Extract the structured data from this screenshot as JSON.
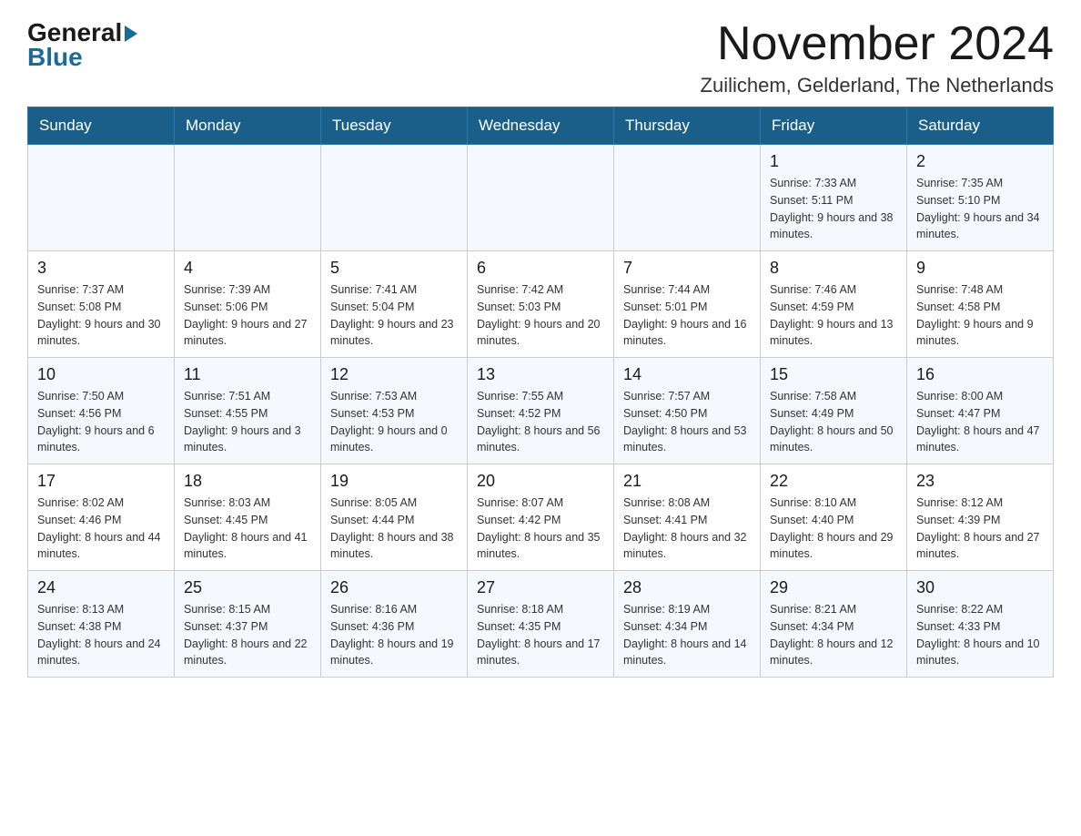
{
  "logo": {
    "general": "General",
    "blue": "Blue"
  },
  "header": {
    "title": "November 2024",
    "location": "Zuilichem, Gelderland, The Netherlands"
  },
  "days_of_week": [
    "Sunday",
    "Monday",
    "Tuesday",
    "Wednesday",
    "Thursday",
    "Friday",
    "Saturday"
  ],
  "weeks": [
    [
      {
        "day": "",
        "info": ""
      },
      {
        "day": "",
        "info": ""
      },
      {
        "day": "",
        "info": ""
      },
      {
        "day": "",
        "info": ""
      },
      {
        "day": "",
        "info": ""
      },
      {
        "day": "1",
        "info": "Sunrise: 7:33 AM\nSunset: 5:11 PM\nDaylight: 9 hours and 38 minutes."
      },
      {
        "day": "2",
        "info": "Sunrise: 7:35 AM\nSunset: 5:10 PM\nDaylight: 9 hours and 34 minutes."
      }
    ],
    [
      {
        "day": "3",
        "info": "Sunrise: 7:37 AM\nSunset: 5:08 PM\nDaylight: 9 hours and 30 minutes."
      },
      {
        "day": "4",
        "info": "Sunrise: 7:39 AM\nSunset: 5:06 PM\nDaylight: 9 hours and 27 minutes."
      },
      {
        "day": "5",
        "info": "Sunrise: 7:41 AM\nSunset: 5:04 PM\nDaylight: 9 hours and 23 minutes."
      },
      {
        "day": "6",
        "info": "Sunrise: 7:42 AM\nSunset: 5:03 PM\nDaylight: 9 hours and 20 minutes."
      },
      {
        "day": "7",
        "info": "Sunrise: 7:44 AM\nSunset: 5:01 PM\nDaylight: 9 hours and 16 minutes."
      },
      {
        "day": "8",
        "info": "Sunrise: 7:46 AM\nSunset: 4:59 PM\nDaylight: 9 hours and 13 minutes."
      },
      {
        "day": "9",
        "info": "Sunrise: 7:48 AM\nSunset: 4:58 PM\nDaylight: 9 hours and 9 minutes."
      }
    ],
    [
      {
        "day": "10",
        "info": "Sunrise: 7:50 AM\nSunset: 4:56 PM\nDaylight: 9 hours and 6 minutes."
      },
      {
        "day": "11",
        "info": "Sunrise: 7:51 AM\nSunset: 4:55 PM\nDaylight: 9 hours and 3 minutes."
      },
      {
        "day": "12",
        "info": "Sunrise: 7:53 AM\nSunset: 4:53 PM\nDaylight: 9 hours and 0 minutes."
      },
      {
        "day": "13",
        "info": "Sunrise: 7:55 AM\nSunset: 4:52 PM\nDaylight: 8 hours and 56 minutes."
      },
      {
        "day": "14",
        "info": "Sunrise: 7:57 AM\nSunset: 4:50 PM\nDaylight: 8 hours and 53 minutes."
      },
      {
        "day": "15",
        "info": "Sunrise: 7:58 AM\nSunset: 4:49 PM\nDaylight: 8 hours and 50 minutes."
      },
      {
        "day": "16",
        "info": "Sunrise: 8:00 AM\nSunset: 4:47 PM\nDaylight: 8 hours and 47 minutes."
      }
    ],
    [
      {
        "day": "17",
        "info": "Sunrise: 8:02 AM\nSunset: 4:46 PM\nDaylight: 8 hours and 44 minutes."
      },
      {
        "day": "18",
        "info": "Sunrise: 8:03 AM\nSunset: 4:45 PM\nDaylight: 8 hours and 41 minutes."
      },
      {
        "day": "19",
        "info": "Sunrise: 8:05 AM\nSunset: 4:44 PM\nDaylight: 8 hours and 38 minutes."
      },
      {
        "day": "20",
        "info": "Sunrise: 8:07 AM\nSunset: 4:42 PM\nDaylight: 8 hours and 35 minutes."
      },
      {
        "day": "21",
        "info": "Sunrise: 8:08 AM\nSunset: 4:41 PM\nDaylight: 8 hours and 32 minutes."
      },
      {
        "day": "22",
        "info": "Sunrise: 8:10 AM\nSunset: 4:40 PM\nDaylight: 8 hours and 29 minutes."
      },
      {
        "day": "23",
        "info": "Sunrise: 8:12 AM\nSunset: 4:39 PM\nDaylight: 8 hours and 27 minutes."
      }
    ],
    [
      {
        "day": "24",
        "info": "Sunrise: 8:13 AM\nSunset: 4:38 PM\nDaylight: 8 hours and 24 minutes."
      },
      {
        "day": "25",
        "info": "Sunrise: 8:15 AM\nSunset: 4:37 PM\nDaylight: 8 hours and 22 minutes."
      },
      {
        "day": "26",
        "info": "Sunrise: 8:16 AM\nSunset: 4:36 PM\nDaylight: 8 hours and 19 minutes."
      },
      {
        "day": "27",
        "info": "Sunrise: 8:18 AM\nSunset: 4:35 PM\nDaylight: 8 hours and 17 minutes."
      },
      {
        "day": "28",
        "info": "Sunrise: 8:19 AM\nSunset: 4:34 PM\nDaylight: 8 hours and 14 minutes."
      },
      {
        "day": "29",
        "info": "Sunrise: 8:21 AM\nSunset: 4:34 PM\nDaylight: 8 hours and 12 minutes."
      },
      {
        "day": "30",
        "info": "Sunrise: 8:22 AM\nSunset: 4:33 PM\nDaylight: 8 hours and 10 minutes."
      }
    ]
  ]
}
